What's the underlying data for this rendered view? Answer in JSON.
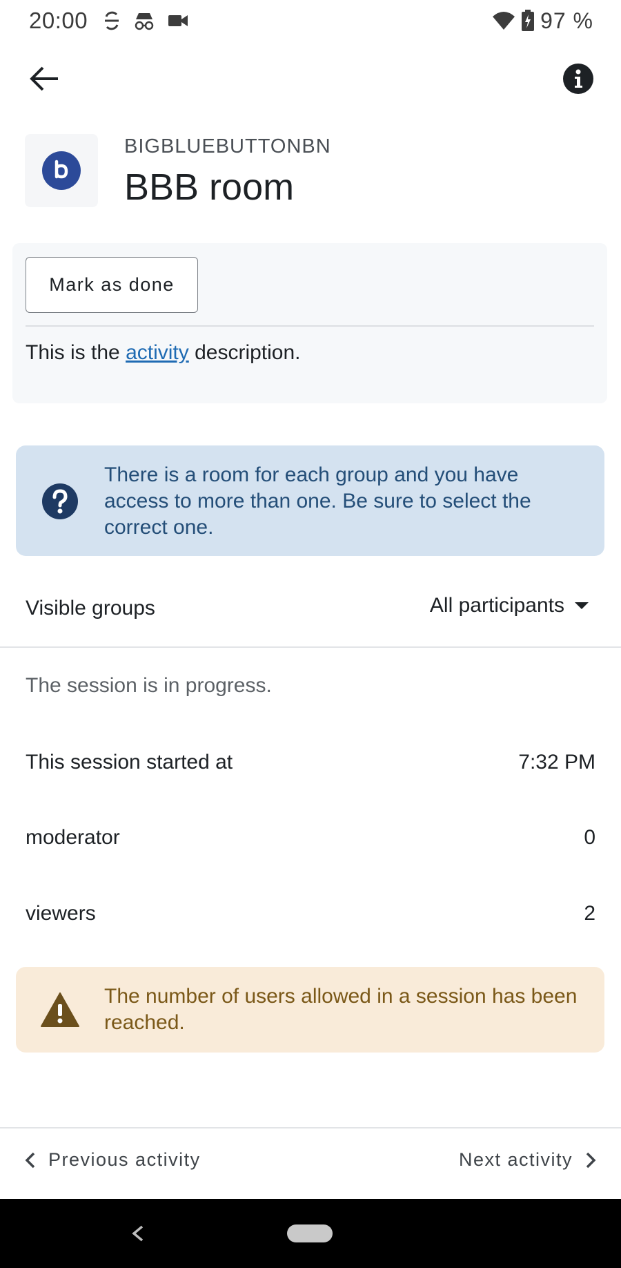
{
  "status_bar": {
    "time": "20:00",
    "battery_percent": "97 %",
    "left_icons": [
      "sync-disabled-icon",
      "incognito-icon",
      "video-camera-icon"
    ],
    "right_icons": [
      "wifi-icon",
      "battery-charging-icon"
    ]
  },
  "app_bar": {
    "back_icon": "arrow-left-icon",
    "info_icon": "info-circle-icon"
  },
  "module": {
    "type_label": "BIGBLUEBUTTONBN",
    "title": "BBB room",
    "icon": "bigbluebutton-logo-icon",
    "icon_color": "#2c4a99"
  },
  "activity": {
    "mark_done_label": "Mark as done",
    "description_before": "This is the ",
    "description_link": "activity",
    "description_after": " description."
  },
  "group_notice": {
    "icon": "question-circle-icon",
    "text": "There is a room for each group and you have access to more than one. Be sure to select the correct one."
  },
  "groups": {
    "label": "Visible groups",
    "selected": "All participants",
    "dropdown_icon": "caret-down-icon"
  },
  "session": {
    "status": "The session is in progress.",
    "rows": [
      {
        "label": "This session started at",
        "value": "7:32 PM"
      },
      {
        "label": "moderator",
        "value": "0"
      },
      {
        "label": "viewers",
        "value": "2"
      }
    ]
  },
  "limit_warning": {
    "icon": "warning-triangle-icon",
    "text": "The number of users allowed in a session has been reached."
  },
  "bottom_nav": {
    "previous_label": "Previous activity",
    "next_label": "Next activity"
  },
  "colors": {
    "link": "#1f6bb3",
    "info_background": "#d4e2f0",
    "info_text": "#244e78",
    "warning_background": "#f9ebd9",
    "warning_text": "#7a5818"
  }
}
